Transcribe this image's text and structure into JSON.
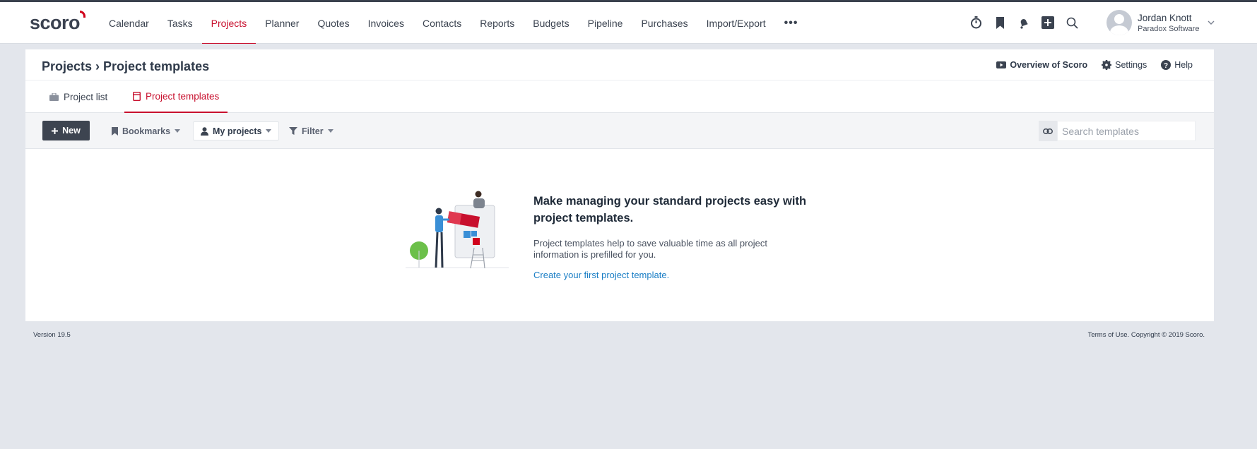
{
  "app": {
    "logo_text": "scoro",
    "brand_color": "#c8102e"
  },
  "nav": {
    "items": [
      {
        "label": "Calendar",
        "active": false
      },
      {
        "label": "Tasks",
        "active": false
      },
      {
        "label": "Projects",
        "active": true
      },
      {
        "label": "Planner",
        "active": false
      },
      {
        "label": "Quotes",
        "active": false
      },
      {
        "label": "Invoices",
        "active": false
      },
      {
        "label": "Contacts",
        "active": false
      },
      {
        "label": "Reports",
        "active": false
      },
      {
        "label": "Budgets",
        "active": false
      },
      {
        "label": "Pipeline",
        "active": false
      },
      {
        "label": "Purchases",
        "active": false
      },
      {
        "label": "Import/Export",
        "active": false
      }
    ],
    "more_label": "•••"
  },
  "top_icons": [
    "timer-icon",
    "bookmark-icon",
    "notifications-bell-icon",
    "add-icon",
    "search-icon"
  ],
  "user": {
    "name": "Jordan Knott",
    "company": "Paradox Software"
  },
  "page": {
    "breadcrumb": "Projects › Project templates",
    "overview_label": "Overview of Scoro",
    "settings_label": "Settings",
    "help_label": "Help"
  },
  "tabs": {
    "project_list": "Project list",
    "project_templates": "Project templates"
  },
  "toolbar": {
    "new_label": "New",
    "bookmarks_label": "Bookmarks",
    "my_projects_label": "My projects",
    "filter_label": "Filter",
    "search_placeholder": "Search templates",
    "search_value": ""
  },
  "empty_state": {
    "title": "Make managing your standard projects easy with project templates.",
    "description": "Project templates help to save valuable time as all project information is prefilled for you.",
    "link": "Create your first project template."
  },
  "footer": {
    "version": "Version 19.5",
    "copyright": "Terms of Use. Copyright © 2019 Scoro."
  }
}
